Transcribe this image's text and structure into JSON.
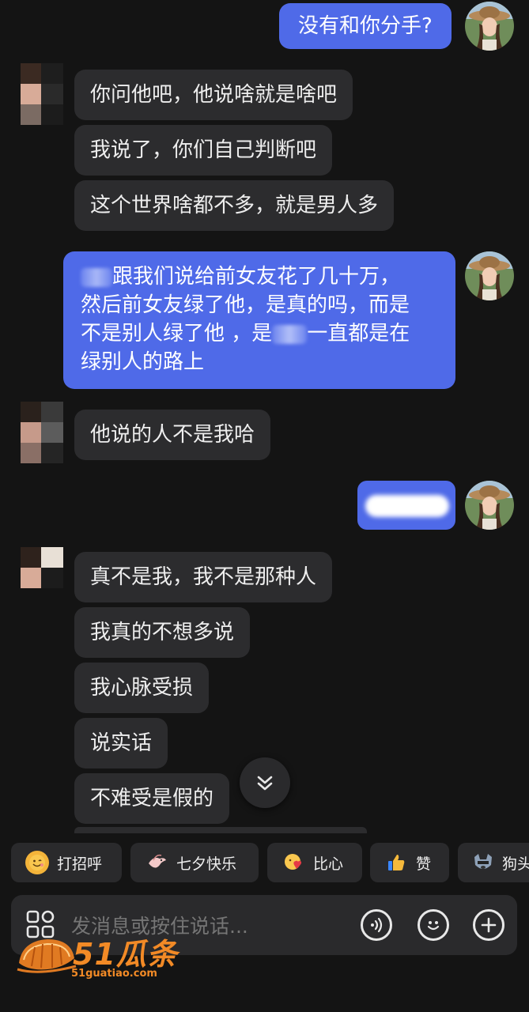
{
  "messages": {
    "m1": "没有和你分手?",
    "m2": "你问他吧，他说啥就是啥吧",
    "m3": "我说了，你们自己判断吧",
    "m4": "这个世界啥都不多，就是男人多",
    "m5_line1": "跟我们说给前女友花了几十万，",
    "m5_line2": "然后前女友绿了他，是真的吗，而是",
    "m5_line3a": "不是别人绿了他 ，是",
    "m5_line3b": "一直都是在",
    "m5_line4": "绿别人的路上",
    "m6": "他说的人不是我哈",
    "m8": "真不是我，我不是那种人",
    "m9": "我真的不想多说",
    "m10": "我心脉受损",
    "m11": "说实话",
    "m12": "不难受是假的"
  },
  "quick_replies": [
    {
      "label": "打招呼",
      "icon": "smile-face-icon"
    },
    {
      "label": "七夕快乐",
      "icon": "bird-icon"
    },
    {
      "label": "比心",
      "icon": "heart-hands-icon"
    },
    {
      "label": "赞",
      "icon": "thumbs-up-icon"
    },
    {
      "label": "狗头",
      "icon": "dog-head-icon"
    }
  ],
  "input": {
    "placeholder": "发消息或按住说话..."
  },
  "watermark": {
    "brand": "51瓜条",
    "url": "51guatiao.com"
  },
  "colors": {
    "outgoing_bubble": "#4f6ae8",
    "incoming_bubble": "#2c2c2e",
    "background": "#141414"
  }
}
